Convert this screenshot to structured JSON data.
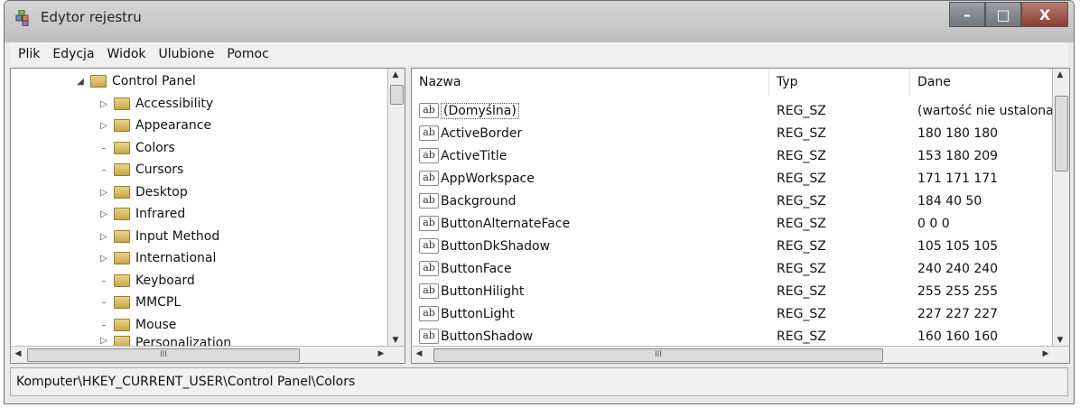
{
  "window": {
    "title": "Edytor rejestru",
    "minimize": "–",
    "maximize": "□",
    "close": "X"
  },
  "menu": [
    "Plik",
    "Edycja",
    "Widok",
    "Ulubione",
    "Pomoc"
  ],
  "tree": {
    "root": "Control Panel",
    "items": [
      "Accessibility",
      "Appearance",
      "Colors",
      "Cursors",
      "Desktop",
      "Infrared",
      "Input Method",
      "International",
      "Keyboard",
      "MMCPL",
      "Mouse",
      "Personalization"
    ],
    "scroll_label": "III"
  },
  "values": {
    "columns": {
      "name": "Nazwa",
      "type": "Typ",
      "data": "Dane"
    },
    "rows": [
      {
        "name": "(Domyślna)",
        "type": "REG_SZ",
        "data": "(wartość nie ustalona)"
      },
      {
        "name": "ActiveBorder",
        "type": "REG_SZ",
        "data": "180 180 180"
      },
      {
        "name": "ActiveTitle",
        "type": "REG_SZ",
        "data": "153 180 209"
      },
      {
        "name": "AppWorkspace",
        "type": "REG_SZ",
        "data": "171 171 171"
      },
      {
        "name": "Background",
        "type": "REG_SZ",
        "data": "184 40 50"
      },
      {
        "name": "ButtonAlternateFace",
        "type": "REG_SZ",
        "data": "0 0 0"
      },
      {
        "name": "ButtonDkShadow",
        "type": "REG_SZ",
        "data": "105 105 105"
      },
      {
        "name": "ButtonFace",
        "type": "REG_SZ",
        "data": "240 240 240"
      },
      {
        "name": "ButtonHilight",
        "type": "REG_SZ",
        "data": "255 255 255"
      },
      {
        "name": "ButtonLight",
        "type": "REG_SZ",
        "data": "227 227 227"
      },
      {
        "name": "ButtonShadow",
        "type": "REG_SZ",
        "data": "160 160 160"
      }
    ],
    "icon_text": "ab",
    "scroll_label": "III"
  },
  "status": {
    "path": "Komputer\\HKEY_CURRENT_USER\\Control Panel\\Colors"
  }
}
